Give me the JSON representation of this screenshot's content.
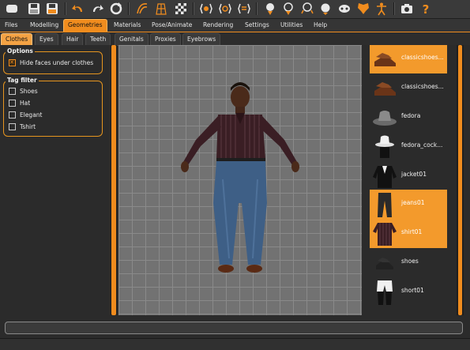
{
  "toolbar": {
    "icons": [
      "new-icon",
      "save-icon",
      "export-icon",
      "undo-icon",
      "redo-icon",
      "reset-icon",
      "smooth-icon",
      "wireframe-icon",
      "checker-icon",
      "front-view-icon",
      "side-view-icon",
      "back-view-icon",
      "head-icon",
      "head-left-icon",
      "head-right-icon",
      "face-icon",
      "mask-icon",
      "pose-icon",
      "skeleton-icon",
      "camera-icon",
      "help-icon"
    ]
  },
  "menu": {
    "tabs": [
      "Files",
      "Modelling",
      "Geometries",
      "Materials",
      "Pose/Animate",
      "Rendering",
      "Settings",
      "Utilities",
      "Help"
    ],
    "active": "Geometries"
  },
  "subtabs": {
    "tabs": [
      "Clothes",
      "Eyes",
      "Hair",
      "Teeth",
      "Genitals",
      "Proxies",
      "Eyebrows"
    ],
    "active": "Clothes"
  },
  "options": {
    "title": "Options",
    "hide_faces_label": "Hide faces under clothes",
    "hide_faces_checked": true
  },
  "tagfilter": {
    "title": "Tag filter",
    "items": [
      "Shoes",
      "Hat",
      "Elegant",
      "Tshirt"
    ]
  },
  "clothes": {
    "items": [
      {
        "label": "classicshoes...",
        "selected": true
      },
      {
        "label": "classicshoes...",
        "selected": false
      },
      {
        "label": "fedora",
        "selected": false
      },
      {
        "label": "fedora_cock...",
        "selected": false
      },
      {
        "label": "jacket01",
        "selected": false
      },
      {
        "label": "jeans01",
        "selected": true
      },
      {
        "label": "shirt01",
        "selected": true
      },
      {
        "label": "shoes",
        "selected": false
      },
      {
        "label": "short01",
        "selected": false
      }
    ]
  },
  "status": {
    "text": ""
  },
  "colors": {
    "accent": "#f08c1e",
    "panel": "#2b2b2b",
    "viewport": "#727272"
  }
}
